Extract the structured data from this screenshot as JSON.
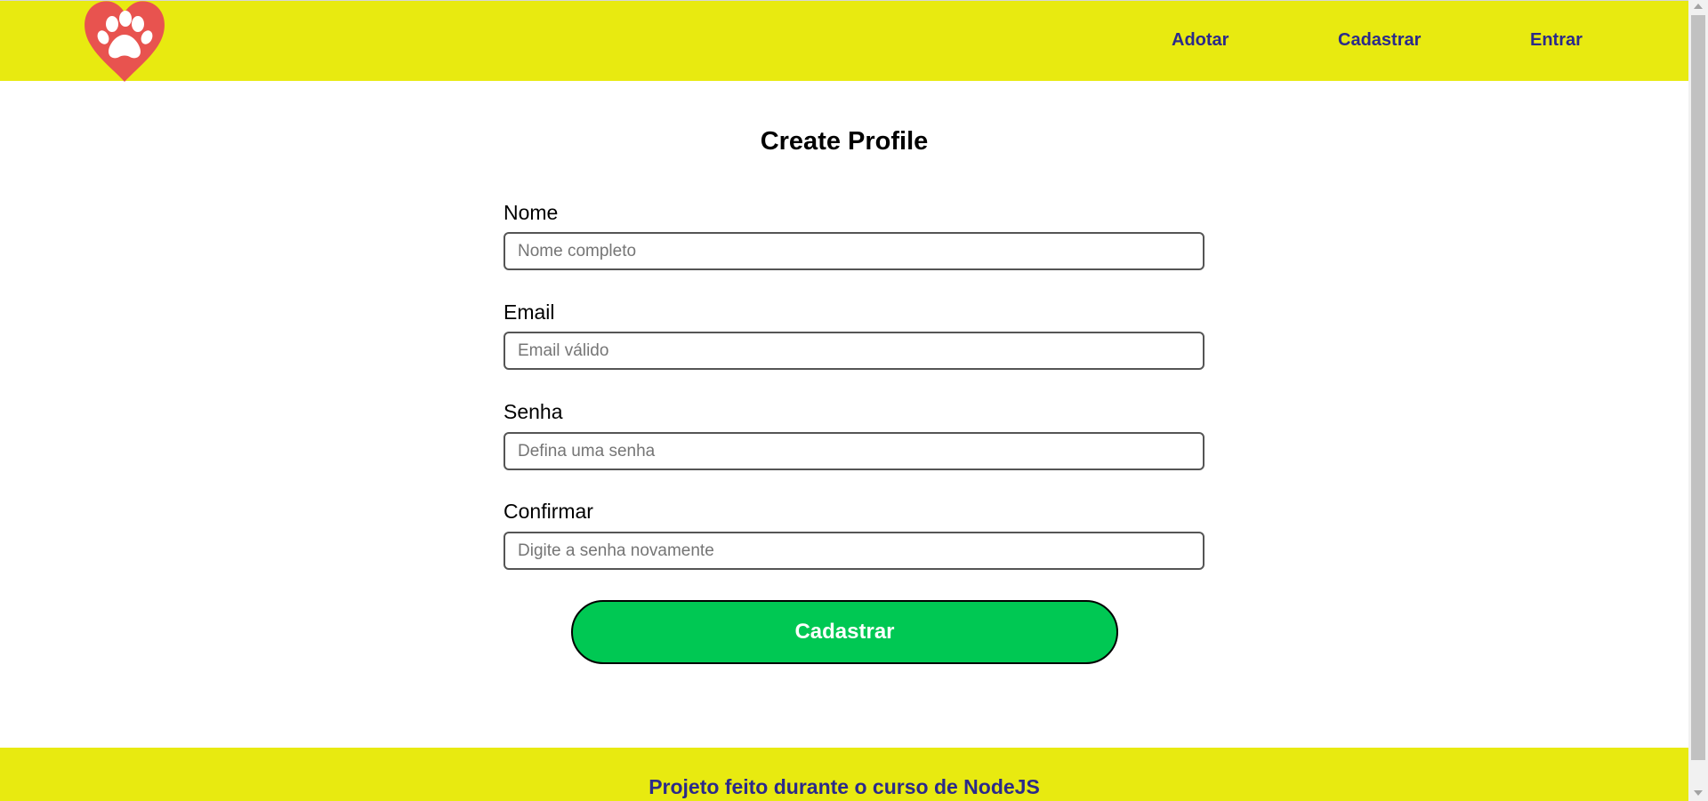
{
  "header": {
    "logo_icon": "heart-paw-icon",
    "colors": {
      "background": "#e8ea10",
      "link": "#2b2a8a",
      "heart": "#e8534f"
    },
    "nav": {
      "adopt_label": "Adotar",
      "register_label": "Cadastrar",
      "login_label": "Entrar"
    }
  },
  "main": {
    "title": "Create Profile",
    "fields": {
      "name": {
        "label": "Nome",
        "placeholder": "Nome completo",
        "value": ""
      },
      "email": {
        "label": "Email",
        "placeholder": "Email válido",
        "value": ""
      },
      "password": {
        "label": "Senha",
        "placeholder": "Defina uma senha",
        "value": ""
      },
      "confirm": {
        "label": "Confirmar",
        "placeholder": "Digite a senha novamente",
        "value": ""
      }
    },
    "submit_label": "Cadastrar",
    "submit_color": "#00c853"
  },
  "footer": {
    "text": "Projeto feito durante o curso de NodeJS"
  }
}
